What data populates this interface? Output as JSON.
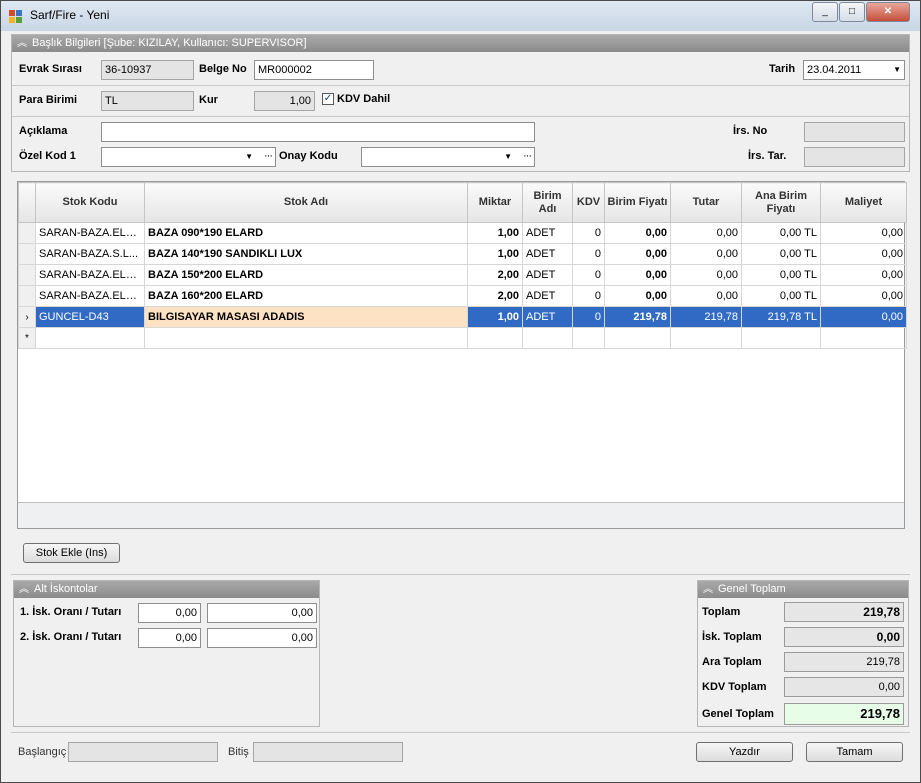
{
  "window": {
    "title": "Sarf/Fire - Yeni",
    "controls": [
      "_",
      "□",
      "✕"
    ]
  },
  "header_section": {
    "title": "Başlık Bilgileri [Şube: KIZILAY, Kullanıcı: SUPERVISOR]",
    "evrak_sirasi_label": "Evrak Sırası",
    "evrak_sirasi_value": "36-10937",
    "belge_no_label": "Belge No",
    "belge_no_value": "MR000002",
    "tarih_label": "Tarih",
    "tarih_value": "23.04.2011",
    "para_birimi_label": "Para Birimi",
    "para_birimi_value": "TL",
    "kur_label": "Kur",
    "kur_value": "1,00",
    "kdv_dahil_label": "KDV Dahil",
    "kdv_dahil_checked": true,
    "aciklama_label": "Açıklama",
    "aciklama_value": "",
    "ozel_kod_label": "Özel Kod 1",
    "ozel_kod_value": "",
    "onay_kodu_label": "Onay Kodu",
    "onay_kodu_value": "",
    "irs_no_label": "İrs. No",
    "irs_no_value": "",
    "irs_tar_label": "İrs. Tar.",
    "irs_tar_value": ""
  },
  "grid": {
    "columns": [
      "Stok Kodu",
      "Stok Adı",
      "Miktar",
      "Birim Adı",
      "KDV",
      "Birim Fiyatı",
      "Tutar",
      "Ana Birim Fiyatı",
      "Maliyet"
    ],
    "rows": [
      {
        "indicator": "",
        "stok_kodu": "SARAN-BAZA.ELR...",
        "stok_adi": "BAZA 090*190 ELARD",
        "miktar": "1,00",
        "birim": "ADET",
        "kdv": "0",
        "birim_fiyati": "0,00",
        "tutar": "0,00",
        "ana_birim_fiyati": "0,00 TL",
        "maliyet": "0,00"
      },
      {
        "indicator": "",
        "stok_kodu": "SARAN-BAZA.S.L...",
        "stok_adi": "BAZA 140*190 SANDIKLI LUX",
        "miktar": "1,00",
        "birim": "ADET",
        "kdv": "0",
        "birim_fiyati": "0,00",
        "tutar": "0,00",
        "ana_birim_fiyati": "0,00 TL",
        "maliyet": "0,00"
      },
      {
        "indicator": "",
        "stok_kodu": "SARAN-BAZA.ELR...",
        "stok_adi": "BAZA 150*200 ELARD",
        "miktar": "2,00",
        "birim": "ADET",
        "kdv": "0",
        "birim_fiyati": "0,00",
        "tutar": "0,00",
        "ana_birim_fiyati": "0,00 TL",
        "maliyet": "0,00"
      },
      {
        "indicator": "",
        "stok_kodu": "SARAN-BAZA.ELR...",
        "stok_adi": "BAZA 160*200 ELARD",
        "miktar": "2,00",
        "birim": "ADET",
        "kdv": "0",
        "birim_fiyati": "0,00",
        "tutar": "0,00",
        "ana_birim_fiyati": "0,00 TL",
        "maliyet": "0,00"
      },
      {
        "indicator": "›",
        "stok_kodu": "GUNCEL-D43",
        "stok_adi": "BILGISAYAR MASASI ADADIS",
        "miktar": "1,00",
        "birim": "ADET",
        "kdv": "0",
        "birim_fiyati": "219,78",
        "tutar": "219,78",
        "ana_birim_fiyati": "219,78 TL",
        "maliyet": "0,00"
      }
    ],
    "new_row_indicator": "*",
    "selected_row": 4
  },
  "stok_ekle_button": "Stok Ekle (Ins)",
  "alt_iskontolar": {
    "title": "Alt İskontolar",
    "row1_label": "1. İsk. Oranı / Tutarı",
    "row1_rate": "0,00",
    "row1_amount": "0,00",
    "row2_label": "2. İsk. Oranı / Tutarı",
    "row2_rate": "0,00",
    "row2_amount": "0,00"
  },
  "genel_toplam": {
    "title": "Genel Toplam",
    "toplam_label": "Toplam",
    "toplam_value": "219,78",
    "isk_toplam_label": "İsk. Toplam",
    "isk_toplam_value": "0,00",
    "ara_toplam_label": "Ara Toplam",
    "ara_toplam_value": "219,78",
    "kdv_toplam_label": "KDV Toplam",
    "kdv_toplam_value": "0,00",
    "genel_toplam_label": "Genel Toplam",
    "genel_toplam_value": "219,78"
  },
  "footer": {
    "baslangic_label": "Başlangıç",
    "baslangic_value": "",
    "bitis_label": "Bitiş",
    "bitis_value": "",
    "yazdir_button": "Yazdır",
    "tamam_button": "Tamam"
  },
  "colors": {
    "selection": "#316ac5",
    "edit_cell": "#fde3c4",
    "grand_total_bg": "#e8fde8"
  }
}
